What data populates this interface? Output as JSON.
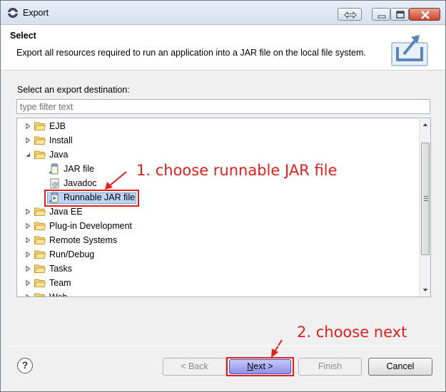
{
  "window": {
    "title": "Export",
    "controls": [
      "sync",
      "minimize",
      "maximize",
      "close"
    ]
  },
  "header": {
    "title": "Select",
    "description": "Export all resources required to run an application into a JAR file on the local file system."
  },
  "destination": {
    "label": "Select an export destination:",
    "filter_placeholder": "type filter text"
  },
  "tree": {
    "items": [
      {
        "label": "EJB",
        "type": "folder",
        "expanded": false
      },
      {
        "label": "Install",
        "type": "folder",
        "expanded": false
      },
      {
        "label": "Java",
        "type": "folder",
        "expanded": true
      },
      {
        "label": "JAR file",
        "type": "jar-icon"
      },
      {
        "label": "Javadoc",
        "type": "javadoc-icon"
      },
      {
        "label": "Runnable JAR file",
        "type": "runnable-jar-icon",
        "selected": true
      },
      {
        "label": "Java EE",
        "type": "folder",
        "expanded": false
      },
      {
        "label": "Plug-in Development",
        "type": "folder",
        "expanded": false
      },
      {
        "label": "Remote Systems",
        "type": "folder",
        "expanded": false
      },
      {
        "label": "Run/Debug",
        "type": "folder",
        "expanded": false
      },
      {
        "label": "Tasks",
        "type": "folder",
        "expanded": false
      },
      {
        "label": "Team",
        "type": "folder",
        "expanded": false
      },
      {
        "label": "Web",
        "type": "folder",
        "expanded": false
      }
    ]
  },
  "annotations": {
    "step1": "1. choose runnable JAR file",
    "step2": "2. choose next"
  },
  "buttons": {
    "help": "?",
    "back": "< Back",
    "next_mnemonic": "N",
    "next_rest": "ext >",
    "finish": "Finish",
    "cancel": "Cancel"
  },
  "colors": {
    "annotation": "#e0201f",
    "selection": "#bcd5f5",
    "next_button": "#8f91ea",
    "close_button": "#c9452c"
  }
}
